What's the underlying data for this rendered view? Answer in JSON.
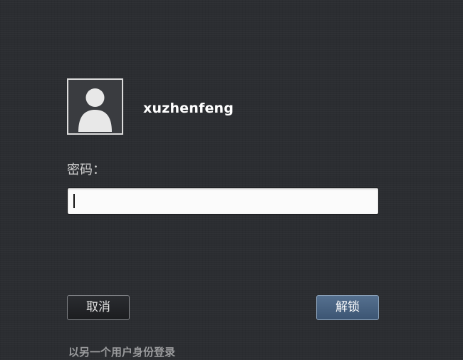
{
  "user": {
    "name": "xuzhenfeng",
    "avatar_icon": "user-avatar-icon"
  },
  "password": {
    "label": "密码：",
    "value": ""
  },
  "buttons": {
    "cancel_label": "取消",
    "unlock_label": "解锁"
  },
  "switch_user_label": "以另一个用户身份登录",
  "colors": {
    "background": "#2b2d31",
    "unlock_button": "#4a6382",
    "input_background": "#fbfbfb",
    "text_primary": "#ffffff",
    "text_secondary": "#9a9b9d"
  }
}
